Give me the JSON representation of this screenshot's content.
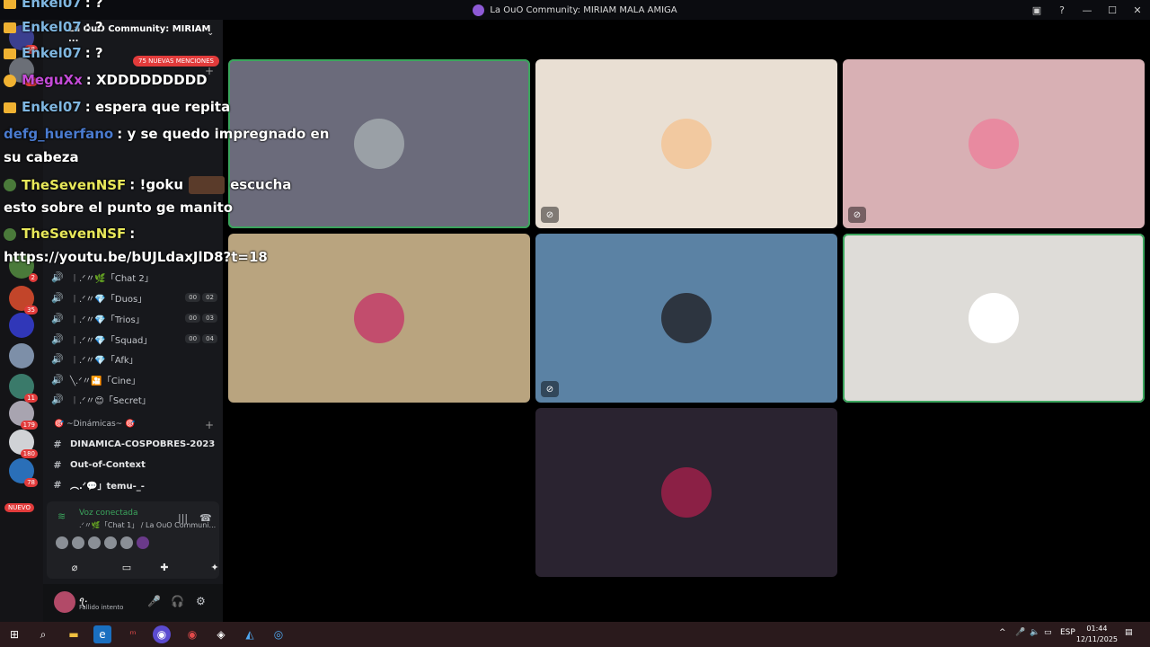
{
  "window": {
    "title": "La OuO Community: MIRIAM MALA AMIGA",
    "controls": {
      "minimize": "—",
      "maximize": "☐",
      "close": "✕"
    }
  },
  "rail": {
    "badges": [
      "68",
      "77",
      "2",
      "35",
      "11",
      "179",
      "180",
      "78"
    ],
    "nuevo": "NUEVO"
  },
  "sidebar": {
    "server_name": "La OuO Community: MIRIAM ...",
    "mentions": "75 NUEVAS MENCIONES",
    "voice_channels": [
      {
        "label": "︱.ᐟ〃🌿「Chat 2」",
        "counts": []
      },
      {
        "label": "︱.ᐟ〃💎「Duos」",
        "counts": [
          "00",
          "02"
        ]
      },
      {
        "label": "︱.ᐟ〃💎「Trios」",
        "counts": [
          "00",
          "03"
        ]
      },
      {
        "label": "︱.ᐟ〃💎「Squad」",
        "counts": [
          "00",
          "04"
        ]
      },
      {
        "label": "︱.ᐟ〃💎「Afk」",
        "counts": []
      },
      {
        "label": "╲.ᐟ〃🎦「Cine」",
        "counts": []
      },
      {
        "label": "︱.ᐟ〃😊「Secret」",
        "counts": []
      }
    ],
    "category": "🎯 ~Dinámicas~ 🎯",
    "text_channels": [
      {
        "label": "DINAMICA-COSPOBRES-2023"
      },
      {
        "label": "Out-of-Context"
      },
      {
        "label": "︵.ᐟ💬」temu-_-"
      }
    ],
    "voice_panel": {
      "status": "Voz conectada",
      "sub": ".ᐟ〃🌿「Chat 1」 / La OuO Communi..."
    },
    "user": {
      "name": "ꪖ.",
      "status": "Fallido intento"
    }
  },
  "overlay": {
    "lines": [
      {
        "name": "Enkel07",
        "name_color": "#7fb6e0",
        "text": ": ?"
      },
      {
        "name": "Enkel07",
        "name_color": "#7fb6e0",
        "text": ": ?"
      },
      {
        "name": "MeguXx",
        "name_color": "#c44bd8",
        "text": ": XDDDDDDDDD"
      },
      {
        "name": "Enkel07",
        "name_color": "#7fb6e0",
        "text": ": espera que repita"
      },
      {
        "name": "defg_huerfano",
        "name_color": "#4a7bd0",
        "text": ": y se quedo impregnado en"
      },
      {
        "name": "",
        "name_color": "#ffffff",
        "text": "su cabeza"
      },
      {
        "name": "TheSevenNSF",
        "name_color": "#e8e85a",
        "text": ": !goku",
        "after": "escucha"
      },
      {
        "name": "",
        "name_color": "#ffffff",
        "text": "esto sobre el punto ge manito"
      },
      {
        "name": "TheSevenNSF",
        "name_color": "#e8e85a",
        "text": ":"
      },
      {
        "name": "",
        "name_color": "#ffffff",
        "text": "https://youtu.be/bUJLdaxJlD8?t=18"
      }
    ]
  },
  "grid": {
    "tiles": [
      {
        "bg": "#6b6b7b",
        "av": "#9aa0a6",
        "speaking": true,
        "muted": false
      },
      {
        "bg": "#e9dfd3",
        "av": "#f2c9a0",
        "speaking": false,
        "muted": true
      },
      {
        "bg": "#d8b0b4",
        "av": "#e88aa0",
        "speaking": false,
        "muted": true
      },
      {
        "bg": "#b9a47f",
        "av": "#c24d6d",
        "speaking": false,
        "muted": false
      },
      {
        "bg": "#5b82a4",
        "av": "#2d3540",
        "speaking": false,
        "muted": true
      },
      {
        "bg": "#dedcd8",
        "av": "#ffffff",
        "speaking": true,
        "muted": false
      },
      {
        "bg": "#2a2330",
        "av": "#8b2045",
        "speaking": false,
        "muted": false
      }
    ]
  },
  "taskbar": {
    "lang": "ESP",
    "time": "01:44",
    "date": "12/11/2025"
  }
}
